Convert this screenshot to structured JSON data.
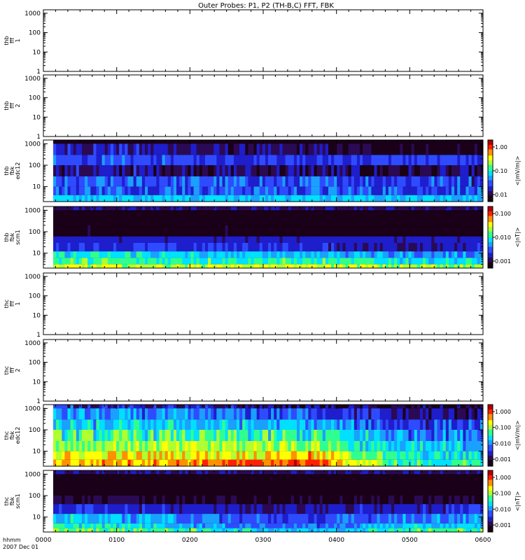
{
  "title": "Outer Probes: P1, P2 (TH-B,C) FFT, FBK",
  "time_axis": {
    "row_label": "hhmm",
    "date_label": "2007 Dec 01",
    "ticks": [
      "0000",
      "0100",
      "0200",
      "0300",
      "0400",
      "0500",
      "0600"
    ]
  },
  "colors": {
    "black": "#000000",
    "colormap": [
      "#1a0018",
      "#2b0a55",
      "#1e1ecc",
      "#2f4bff",
      "#1aa0ff",
      "#00e0ff",
      "#30ff90",
      "#b0ff30",
      "#ffff00",
      "#ff9000",
      "#ff2000",
      "#b00000"
    ]
  },
  "chart_data": [
    {
      "type": "heatmap",
      "panel": "thb-fff1",
      "ylabel": [
        "thb",
        "fff",
        "1"
      ],
      "y_ticks": [
        "1000",
        "100",
        "10",
        "1"
      ],
      "y_log": true,
      "ylim": [
        1,
        1500
      ],
      "has_data": false,
      "bands": [],
      "colorbar": null
    },
    {
      "type": "heatmap",
      "panel": "thb-fff2",
      "ylabel": [
        "thb",
        "fff",
        "2"
      ],
      "y_ticks": [
        "1000",
        "100",
        "10",
        "1"
      ],
      "y_log": true,
      "ylim": [
        1,
        1500
      ],
      "has_data": false,
      "bands": [],
      "colorbar": null
    },
    {
      "type": "heatmap",
      "panel": "thb-fbk-edc12",
      "ylabel": [
        "thb",
        "fbk",
        "edc12"
      ],
      "y_ticks": [
        "1000",
        "100",
        "10"
      ],
      "y_log": true,
      "ylim": [
        2,
        1500
      ],
      "has_data": true,
      "bands": [
        {
          "ymin": 1000,
          "ymax": 1500,
          "levels": [
            0.0,
            0.0,
            0.0,
            0.0,
            0.0,
            0.0
          ],
          "var": 0.06
        },
        {
          "ymin": 300,
          "ymax": 1000,
          "levels": [
            0.22,
            0.2,
            0.12,
            0.12,
            0.05,
            0.03
          ],
          "var": 0.08
        },
        {
          "ymin": 100,
          "ymax": 300,
          "levels": [
            0.28,
            0.28,
            0.27,
            0.26,
            0.26,
            0.26
          ],
          "var": 0.06
        },
        {
          "ymin": 30,
          "ymax": 100,
          "levels": [
            0.16,
            0.16,
            0.14,
            0.13,
            0.1,
            0.1
          ],
          "var": 0.1
        },
        {
          "ymin": 10,
          "ymax": 30,
          "levels": [
            0.28,
            0.3,
            0.28,
            0.28,
            0.26,
            0.26
          ],
          "var": 0.1
        },
        {
          "ymin": 4,
          "ymax": 10,
          "levels": [
            0.28,
            0.3,
            0.3,
            0.3,
            0.28,
            0.28
          ],
          "var": 0.1
        },
        {
          "ymin": 2,
          "ymax": 4,
          "levels": [
            0.42,
            0.42,
            0.42,
            0.42,
            0.42,
            0.42
          ],
          "var": 0.04
        }
      ],
      "colorbar": {
        "label": "<|mV/m|>",
        "ticks": [
          "1.00",
          "0.10",
          "0.01"
        ]
      }
    },
    {
      "type": "heatmap",
      "panel": "thb-fbk-scm1",
      "ylabel": [
        "thb",
        "fbk",
        "scm1"
      ],
      "y_ticks": [
        "1000",
        "100",
        "10"
      ],
      "y_log": true,
      "ylim": [
        2,
        1500
      ],
      "has_data": true,
      "bands": [
        {
          "ymin": 1000,
          "ymax": 1500,
          "levels": [
            0.16,
            0.16,
            0.16,
            0.16,
            0.16,
            0.16
          ],
          "var": 0.02
        },
        {
          "ymin": 200,
          "ymax": 1000,
          "levels": [
            0.0,
            0.0,
            0.0,
            0.0,
            0.0,
            0.0
          ],
          "var": 0.04
        },
        {
          "ymin": 60,
          "ymax": 200,
          "levels": [
            0.05,
            0.05,
            0.05,
            0.04,
            0.04,
            0.04
          ],
          "var": 0.04
        },
        {
          "ymin": 30,
          "ymax": 60,
          "levels": [
            0.2,
            0.2,
            0.2,
            0.2,
            0.2,
            0.2
          ],
          "var": 0.04
        },
        {
          "ymin": 12,
          "ymax": 30,
          "levels": [
            0.24,
            0.25,
            0.24,
            0.22,
            0.18,
            0.2
          ],
          "var": 0.06
        },
        {
          "ymin": 6,
          "ymax": 12,
          "levels": [
            0.48,
            0.46,
            0.42,
            0.42,
            0.36,
            0.36
          ],
          "var": 0.08
        },
        {
          "ymin": 3,
          "ymax": 6,
          "levels": [
            0.54,
            0.52,
            0.52,
            0.52,
            0.48,
            0.46
          ],
          "var": 0.08
        },
        {
          "ymin": 2,
          "ymax": 3,
          "levels": [
            0.66,
            0.64,
            0.66,
            0.66,
            0.62,
            0.6
          ],
          "var": 0.08
        }
      ],
      "colorbar": {
        "label": "<|nT|>",
        "ticks": [
          "0.100",
          "0.010",
          "0.001"
        ]
      }
    },
    {
      "type": "heatmap",
      "panel": "thc-fff1",
      "ylabel": [
        "thc",
        "fff",
        "1"
      ],
      "y_ticks": [
        "1000",
        "100",
        "10",
        "1"
      ],
      "y_log": true,
      "ylim": [
        1,
        1500
      ],
      "has_data": false,
      "bands": [],
      "colorbar": null
    },
    {
      "type": "heatmap",
      "panel": "thc-fff2",
      "ylabel": [
        "thc",
        "fff",
        "2"
      ],
      "y_ticks": [
        "1000",
        "100",
        "10",
        "1"
      ],
      "y_log": true,
      "ylim": [
        1,
        1500
      ],
      "has_data": false,
      "bands": [],
      "colorbar": null
    },
    {
      "type": "heatmap",
      "panel": "thc-fbk-edc12",
      "ylabel": [
        "thc",
        "fbk",
        "edc12"
      ],
      "y_ticks": [
        "1000",
        "100",
        "10"
      ],
      "y_log": true,
      "ylim": [
        2,
        1500
      ],
      "has_data": true,
      "bands": [
        {
          "ymin": 1000,
          "ymax": 1500,
          "levels": [
            0.25,
            0.2,
            0.15,
            0.12,
            0.06,
            0.05
          ],
          "var": 0.12
        },
        {
          "ymin": 300,
          "ymax": 1000,
          "levels": [
            0.36,
            0.34,
            0.32,
            0.3,
            0.16,
            0.14
          ],
          "var": 0.1
        },
        {
          "ymin": 100,
          "ymax": 300,
          "levels": [
            0.42,
            0.42,
            0.42,
            0.4,
            0.26,
            0.26
          ],
          "var": 0.1
        },
        {
          "ymin": 30,
          "ymax": 100,
          "levels": [
            0.52,
            0.52,
            0.5,
            0.5,
            0.36,
            0.36
          ],
          "var": 0.12
        },
        {
          "ymin": 10,
          "ymax": 30,
          "levels": [
            0.6,
            0.62,
            0.62,
            0.62,
            0.42,
            0.42
          ],
          "var": 0.1
        },
        {
          "ymin": 4,
          "ymax": 10,
          "levels": [
            0.7,
            0.7,
            0.72,
            0.74,
            0.48,
            0.46
          ],
          "var": 0.1
        },
        {
          "ymin": 2,
          "ymax": 4,
          "levels": [
            0.76,
            0.78,
            0.82,
            0.86,
            0.52,
            0.5
          ],
          "var": 0.08
        }
      ],
      "colorbar": {
        "label": "<|mV/m|>",
        "ticks": [
          "1.000",
          "0.100",
          "0.010",
          "0.001"
        ]
      }
    },
    {
      "type": "heatmap",
      "panel": "thc-fbk-scm1",
      "ylabel": [
        "thc",
        "fbk",
        "scm1"
      ],
      "y_ticks": [
        "1000",
        "100",
        "10"
      ],
      "y_log": true,
      "ylim": [
        2,
        1500
      ],
      "has_data": true,
      "bands": [
        {
          "ymin": 1000,
          "ymax": 1500,
          "levels": [
            0.16,
            0.16,
            0.16,
            0.16,
            0.16,
            0.16
          ],
          "var": 0.02
        },
        {
          "ymin": 100,
          "ymax": 1000,
          "levels": [
            0.0,
            0.0,
            0.0,
            0.0,
            0.0,
            0.0
          ],
          "var": 0.04
        },
        {
          "ymin": 40,
          "ymax": 100,
          "levels": [
            0.1,
            0.08,
            0.05,
            0.05,
            0.08,
            0.08
          ],
          "var": 0.06
        },
        {
          "ymin": 14,
          "ymax": 40,
          "levels": [
            0.24,
            0.22,
            0.2,
            0.18,
            0.22,
            0.22
          ],
          "var": 0.06
        },
        {
          "ymin": 5,
          "ymax": 14,
          "levels": [
            0.44,
            0.4,
            0.3,
            0.26,
            0.34,
            0.36
          ],
          "var": 0.08
        },
        {
          "ymin": 3,
          "ymax": 5,
          "levels": [
            0.5,
            0.46,
            0.36,
            0.3,
            0.42,
            0.44
          ],
          "var": 0.08
        },
        {
          "ymin": 2,
          "ymax": 3,
          "levels": [
            0.58,
            0.56,
            0.48,
            0.42,
            0.52,
            0.56
          ],
          "var": 0.08
        }
      ],
      "colorbar": {
        "label": "<|nT|>",
        "ticks": [
          "1.000",
          "0.100",
          "0.010",
          "0.001"
        ]
      }
    }
  ]
}
